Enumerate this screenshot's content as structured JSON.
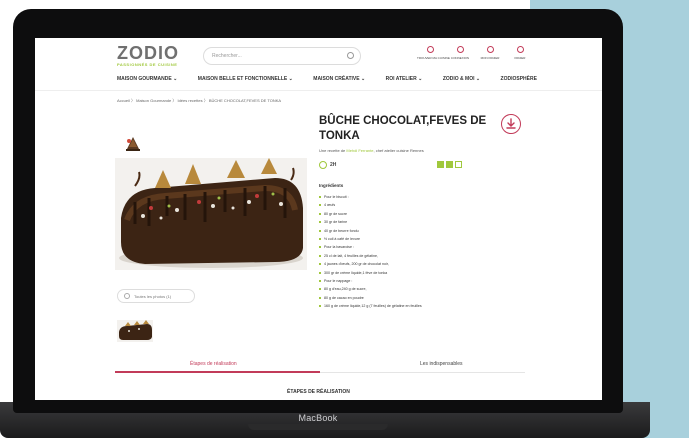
{
  "header": {
    "logo": "ZODIO",
    "logo_tagline": "PASSIONNÉS DE CUISINE",
    "search_placeholder": "Rechercher...",
    "icons": [
      {
        "name": "location-icon",
        "label": "TROUVER MA CUISINE"
      },
      {
        "name": "user-icon",
        "label": "CONNEXION"
      },
      {
        "name": "heart-icon",
        "label": "MON PANIER"
      },
      {
        "name": "cart-icon",
        "label": "PANIER"
      }
    ]
  },
  "nav": [
    "MAISON GOURMANDE ⌄",
    "MAISON BELLE ET FONCTIONNELLE ⌄",
    "MAISON CRÉATIVE ⌄",
    "ROI ATELIER ⌄",
    "ZODIO & MOI ⌄",
    "ZODIOSPHÈRE"
  ],
  "breadcrumb": "Accueil  〉  Maison Gourmande  〉  Idées recettes  〉  BÛCHE CHOCOLAT,FEVES DE TONKA",
  "recipe": {
    "title": "BÛCHE CHOCOLAT,FEVES DE TONKA",
    "byline_prefix": "Une recette de ",
    "byline_name": "Mehdi Ferrante",
    "byline_suffix": ", chef atelier cuisine Rennes",
    "time": "2H",
    "difficulty": 2,
    "ingredients_title": "Ingrédients",
    "ingredients": [
      "Pour le biscuit :",
      "4 œufs",
      "80 gr de sucre",
      "30 gr de farine",
      "40 gr de beurre fondu",
      "½ cuil à café de levure",
      "Pour la bavaroise :",
      "25 cl de lait, 4 feuilles de gélatine,",
      "4 jaunes d'œufs, 200 gr de chocolat noir,",
      "300 gr de crème liquide,1 fève de tonka",
      "Pour le nappage :",
      "80 g d'eau,240 g de sucre,",
      "80 g de cacao en poudre",
      "160 g de crème liquide,12 g (7 feuilles) de gélatine en feuilles"
    ]
  },
  "see_all_photos": "Toutes les photos (1)",
  "tabs": [
    "Étapes de réalisation",
    "Les indispensables"
  ],
  "section_title": "ÉTAPES DE RÉALISATION",
  "device_label": "MacBook",
  "colors": {
    "accent": "#c23b59",
    "green": "#a0c83c",
    "background_right": "#a8d0dc"
  }
}
